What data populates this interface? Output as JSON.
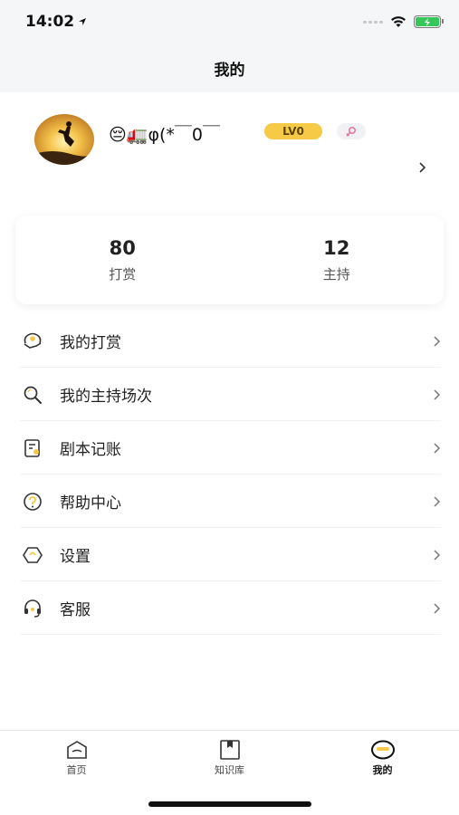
{
  "status_bar": {
    "time": "14:02"
  },
  "nav": {
    "title": "我的"
  },
  "profile": {
    "username": "😔🚛φ(*￣0￣",
    "level": "LV0"
  },
  "stats": [
    {
      "value": "80",
      "label": "打赏"
    },
    {
      "value": "12",
      "label": "主持"
    }
  ],
  "menu": [
    {
      "label": "我的打赏",
      "icon": "reward-icon"
    },
    {
      "label": "我的主持场次",
      "icon": "search-icon"
    },
    {
      "label": "剧本记账",
      "icon": "ledger-icon"
    },
    {
      "label": "帮助中心",
      "icon": "help-icon"
    },
    {
      "label": "设置",
      "icon": "settings-icon"
    },
    {
      "label": "客服",
      "icon": "headset-icon"
    }
  ],
  "tabbar": {
    "tabs": [
      {
        "label": "首页",
        "icon": "home-icon",
        "active": false
      },
      {
        "label": "知识库",
        "icon": "book-icon",
        "active": false
      },
      {
        "label": "我的",
        "icon": "profile-icon",
        "active": true
      }
    ]
  },
  "colors": {
    "accent": "#f6c946",
    "background": "#f5f6f7",
    "battery": "#36c75a"
  }
}
